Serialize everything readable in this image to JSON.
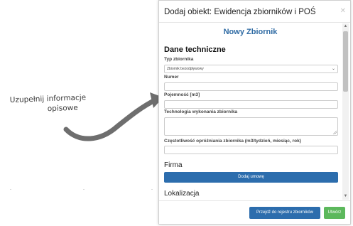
{
  "annotation": {
    "line1": "Uzupełnij informacje",
    "line2": "opisowe"
  },
  "modal": {
    "title": "Dodaj obiekt: Ewidencja zbiorników i POŚ",
    "close_icon": "close-icon",
    "section_title": "Nowy Zbiornik",
    "heading_dane": "Dane techniczne",
    "fields": {
      "typ_label": "Typ zbiornika",
      "typ_value": "Zbiornik bezodpływowy",
      "numer_label": "Numer",
      "numer_value": "",
      "pojemnosc_label": "Pojemność [m3]",
      "pojemnosc_value": "",
      "technologia_label": "Technologia wykonania zbiornika",
      "technologia_value": "",
      "czestotliwosc_label": "Częstotliwość opróżniania zbiornika (m3/tydzień, miesiąc, rok)",
      "czestotliwosc_value": ""
    },
    "heading_firma": "Firma",
    "dodaj_umowe_label": "Dodaj umowę",
    "heading_lokalizacja": "Lokalizacja",
    "footer": {
      "register_label": "Przejdź do rejestru zbiorników",
      "create_label": "Utwórz"
    },
    "colors": {
      "primary": "#2c6dad",
      "success": "#5cb85c",
      "section_title": "#2e6aa3"
    }
  }
}
